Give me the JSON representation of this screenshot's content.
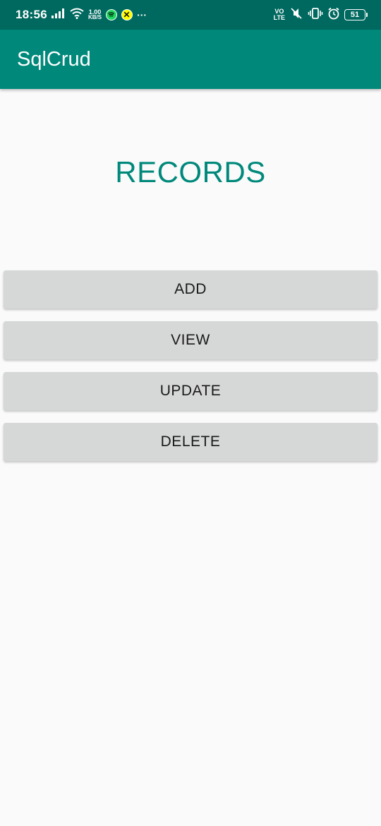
{
  "status_bar": {
    "time": "18:56",
    "net_speed_value": "1.00",
    "net_speed_unit": "KB/S",
    "volte_top": "VO",
    "volte_bottom": "LTE",
    "battery": "51",
    "more": "···",
    "icons": [
      "signal-icon",
      "wifi-icon",
      "spotify-icon",
      "snapchat-icon",
      "mute-icon",
      "vibrate-icon",
      "alarm-icon",
      "battery-icon"
    ]
  },
  "app_bar": {
    "title": "SqlCrud",
    "color": "#00897b"
  },
  "main": {
    "heading": "RECORDS",
    "buttons": {
      "add": "ADD",
      "view": "VIEW",
      "update": "UPDATE",
      "delete": "DELETE"
    }
  },
  "colors": {
    "status_bar": "#00695f",
    "accent": "#00897b",
    "button_bg": "#d6d7d7",
    "background": "#fafafa"
  }
}
